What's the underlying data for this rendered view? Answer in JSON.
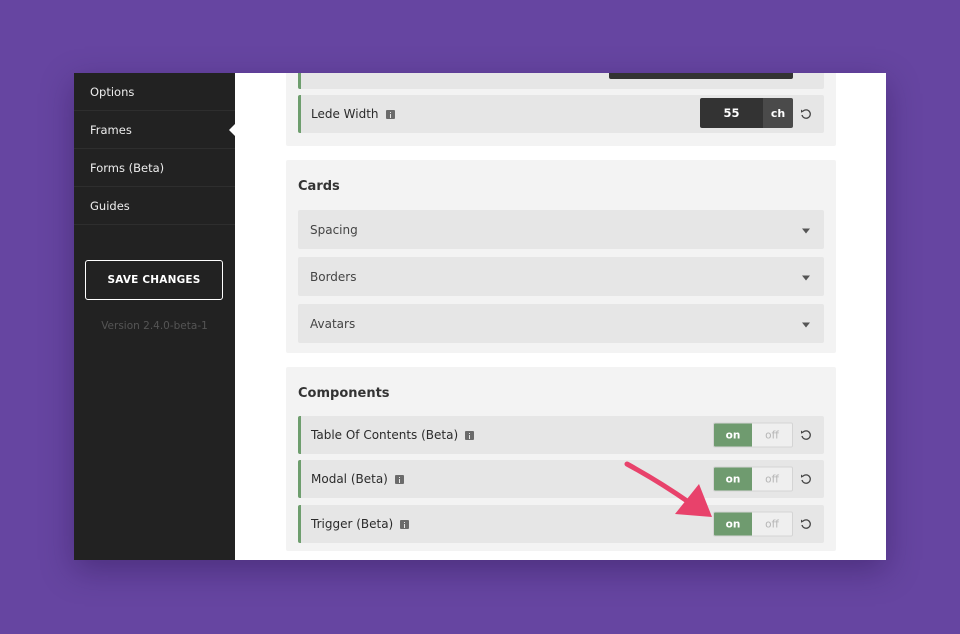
{
  "sidebar": {
    "items": [
      {
        "label": "Options"
      },
      {
        "label": "Frames"
      },
      {
        "label": "Forms (Beta)"
      },
      {
        "label": "Guides"
      }
    ],
    "active_index": 1,
    "save_label": "SAVE CHANGES",
    "version": "Version 2.4.0-beta-1"
  },
  "main": {
    "lede_width": {
      "label": "Lede Width",
      "value": "55",
      "unit": "ch"
    },
    "cards": {
      "title": "Cards",
      "rows": [
        {
          "label": "Spacing"
        },
        {
          "label": "Borders"
        },
        {
          "label": "Avatars"
        }
      ]
    },
    "components": {
      "title": "Components",
      "rows": [
        {
          "label": "Table Of Contents (Beta)",
          "on_label": "on",
          "off_label": "off",
          "state": "on"
        },
        {
          "label": "Modal (Beta)",
          "on_label": "on",
          "off_label": "off",
          "state": "on"
        },
        {
          "label": "Trigger (Beta)",
          "on_label": "on",
          "off_label": "off",
          "state": "on"
        }
      ]
    }
  },
  "colors": {
    "background": "#6645a1",
    "sidebar": "#222222",
    "accent_green": "#6f9b6f",
    "annotation_arrow": "#e8426b"
  },
  "icons": [
    "info-icon",
    "reset-icon",
    "chevron-down-icon",
    "annotation-arrow"
  ]
}
